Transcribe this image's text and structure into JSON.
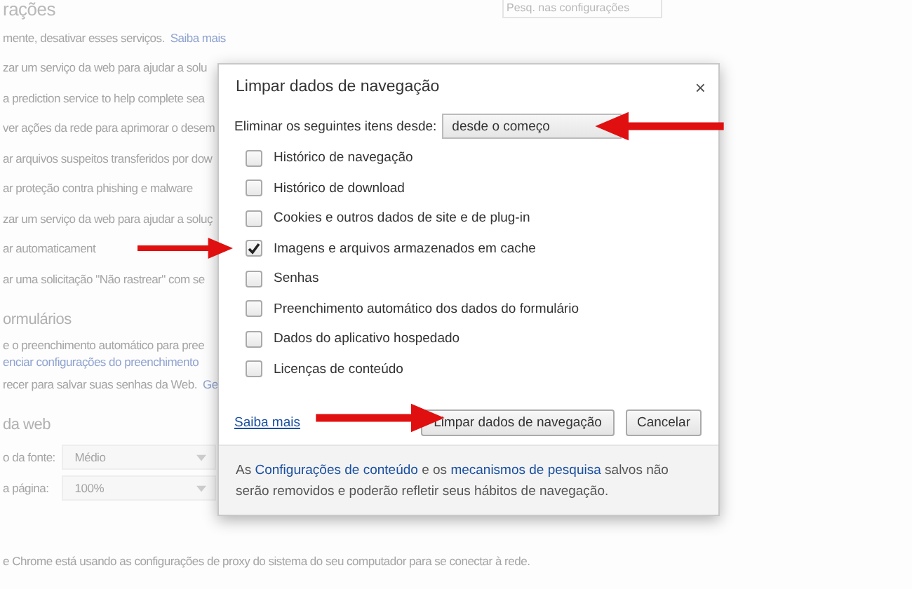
{
  "background": {
    "search": {
      "placeholder": "Pesq. nas configurações"
    },
    "items": [
      {
        "kind": "title",
        "text": "rações"
      },
      {
        "kind": "text",
        "text": "mente, desativar esses serviços.",
        "link": "Saiba mais"
      },
      {
        "kind": "text",
        "text": "zar um serviço da web para ajudar a solu"
      },
      {
        "kind": "text",
        "text": "a prediction service to help complete sea"
      },
      {
        "kind": "text",
        "text": "ver ações da rede para aprimorar o desem"
      },
      {
        "kind": "text",
        "text": "ar arquivos suspeitos transferidos por dow"
      },
      {
        "kind": "text",
        "text": "ar proteção contra phishing e malware"
      },
      {
        "kind": "text",
        "text": "zar um serviço da web para ajudar a soluç"
      },
      {
        "kind": "text",
        "text": "ar automaticament"
      },
      {
        "kind": "text",
        "text": "ar uma solicitação \"Não rastrear\" com se"
      },
      {
        "kind": "heading",
        "text": "ormulários"
      },
      {
        "kind": "tight",
        "text": "e o preenchimento automático para pree"
      },
      {
        "kind": "link",
        "text": "enciar configurações do preenchimento"
      },
      {
        "kind": "text",
        "text": "recer para salvar suas senhas da Web.",
        "link": "Ge"
      },
      {
        "kind": "heading",
        "text": "da web"
      },
      {
        "kind": "select",
        "text": "o da fonte:",
        "value": "Médio"
      },
      {
        "kind": "select",
        "text": "a página:",
        "value": "100%"
      },
      {
        "kind": "footer",
        "text": "e Chrome está usando as configurações de proxy do sistema do seu computador para se conectar à rede."
      }
    ]
  },
  "dialog": {
    "title": "Limpar dados de navegação",
    "close": "×",
    "time_range": {
      "label": "Eliminar os seguintes itens desde:",
      "value": "desde o começo"
    },
    "options": [
      {
        "label": "Histórico de navegação",
        "checked": false
      },
      {
        "label": "Histórico de download",
        "checked": false
      },
      {
        "label": "Cookies e outros dados de site e de plug-in",
        "checked": false
      },
      {
        "label": "Imagens e arquivos armazenados em cache",
        "checked": true
      },
      {
        "label": "Senhas",
        "checked": false
      },
      {
        "label": "Preenchimento automático dos dados do formulário",
        "checked": false
      },
      {
        "label": "Dados do aplicativo hospedado",
        "checked": false
      },
      {
        "label": "Licenças de conteúdo",
        "checked": false
      }
    ],
    "learn_more": "Saiba mais",
    "buttons": [
      {
        "label": "Limpar dados de navegação",
        "primary": true
      },
      {
        "label": "Cancelar",
        "primary": false
      }
    ],
    "footer": [
      {
        "kind": "text",
        "text": "As "
      },
      {
        "kind": "link",
        "text": "Configurações de conteúdo"
      },
      {
        "kind": "text",
        "text": " e os "
      },
      {
        "kind": "link",
        "text": "mecanismos de pesquisa"
      },
      {
        "kind": "text",
        "text": " salvos não serão removidos e poderão refletir seus hábitos de navegação."
      }
    ]
  }
}
